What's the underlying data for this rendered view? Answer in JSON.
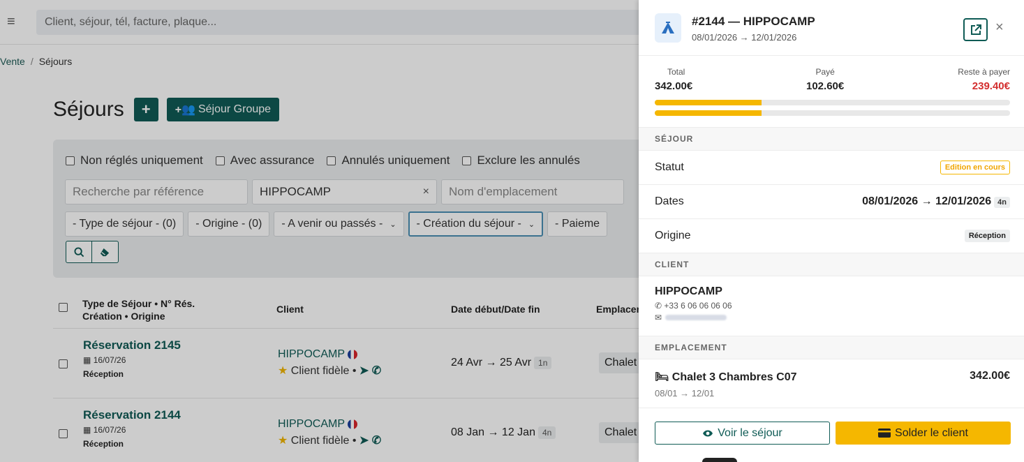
{
  "topbar": {
    "search_placeholder": "Client, séjour, tél, facture, plaque..."
  },
  "breadcrumb": {
    "item1": "Vente",
    "sep": "/",
    "item2": "Séjours"
  },
  "page": {
    "title": "Séjours",
    "add_label": "+",
    "group_label": "Séjour Groupe"
  },
  "filters": {
    "checks": [
      "Non réglés uniquement",
      "Avec assurance",
      "Annulés uniquement",
      "Exclure les annulés"
    ],
    "ref_placeholder": "Recherche par référence",
    "client_value": "HIPPOCAMP",
    "clear_label": "×",
    "emplacement_placeholder": "Nom d'emplacement",
    "selects": [
      "- Type de séjour - (0)",
      "- Origine - (0)",
      "- A venir ou passés -",
      "- Création du séjour -",
      "- Paieme"
    ]
  },
  "table": {
    "col1_line1": "Type de Séjour • N° Rés.",
    "col1_line2": "Création • Origine",
    "col_client": "Client",
    "col_dates": "Date début/Date fin",
    "col_emp": "Emplacer",
    "rows": [
      {
        "title": "Réservation 2145",
        "created": "16/07/26",
        "origin": "Réception",
        "client": "HIPPOCAMP",
        "fidele": "Client fidèle •",
        "dates": "24 Avr → 25 Avr",
        "nights": "1n",
        "emp": "Chalet"
      },
      {
        "title": "Réservation 2144",
        "created": "16/07/26",
        "origin": "Réception",
        "client": "HIPPOCAMP",
        "fidele": "Client fidèle •",
        "dates": "08 Jan → 12 Jan",
        "nights": "4n",
        "emp": "Chalet"
      }
    ]
  },
  "panel": {
    "title": "#2144 — HIPPOCAMP",
    "subtitle": "08/01/2026 → 12/01/2026",
    "close": "×",
    "total_label": "Total",
    "total": "342.00€",
    "paid_label": "Payé",
    "paid": "102.60€",
    "rest_label": "Reste à payer",
    "rest": "239.40€",
    "paid_fraction": 0.3,
    "sejour_section": "SÉJOUR",
    "statut_label": "Statut",
    "statut_value": "Edition en cours",
    "dates_label": "Dates",
    "dates_value": "08/01/2026 → 12/01/2026",
    "nights": "4n",
    "origine_label": "Origine",
    "origine_value": "Réception",
    "client_section": "CLIENT",
    "client_name": "HIPPOCAMP",
    "client_phone": "+33 6 06 06 06 06",
    "emplacement_section": "EMPLACEMENT",
    "emp_name": "Chalet 3 Chambres C07",
    "emp_dates": "08/01 → 12/01",
    "emp_price": "342.00€",
    "btn_view": "Voir le séjour",
    "btn_pay": "Solder le client"
  },
  "colors": {
    "brand": "#0f5b55",
    "warning": "#f5b700",
    "danger": "#d32f2f"
  },
  "icons": [
    "menu-icon",
    "tent-icon",
    "external-link-icon",
    "close-icon",
    "phone-icon",
    "mail-icon",
    "bed-icon",
    "eye-icon",
    "card-icon",
    "search-icon",
    "eraser-icon",
    "telegram-icon",
    "star-icon",
    "calendar-icon"
  ]
}
